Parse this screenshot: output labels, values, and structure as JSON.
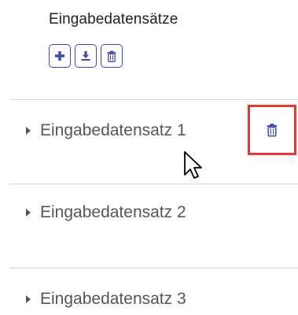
{
  "panel": {
    "title": "Eingabedatensätze"
  },
  "toolbar": {
    "buttons": [
      {
        "icon": "plus-icon",
        "action": "add"
      },
      {
        "icon": "download-icon",
        "action": "download"
      },
      {
        "icon": "trash-icon",
        "action": "delete-all"
      }
    ]
  },
  "records": [
    {
      "label": "Eingabedatensatz 1",
      "delete_visible": true
    },
    {
      "label": "Eingabedatensatz 2",
      "delete_visible": false
    },
    {
      "label": "Eingabedatensatz 3",
      "delete_visible": false
    }
  ],
  "colors": {
    "accent": "#3b4aa8",
    "highlight": "#e53935",
    "divider": "#d9d9d9",
    "text": "#555555"
  }
}
